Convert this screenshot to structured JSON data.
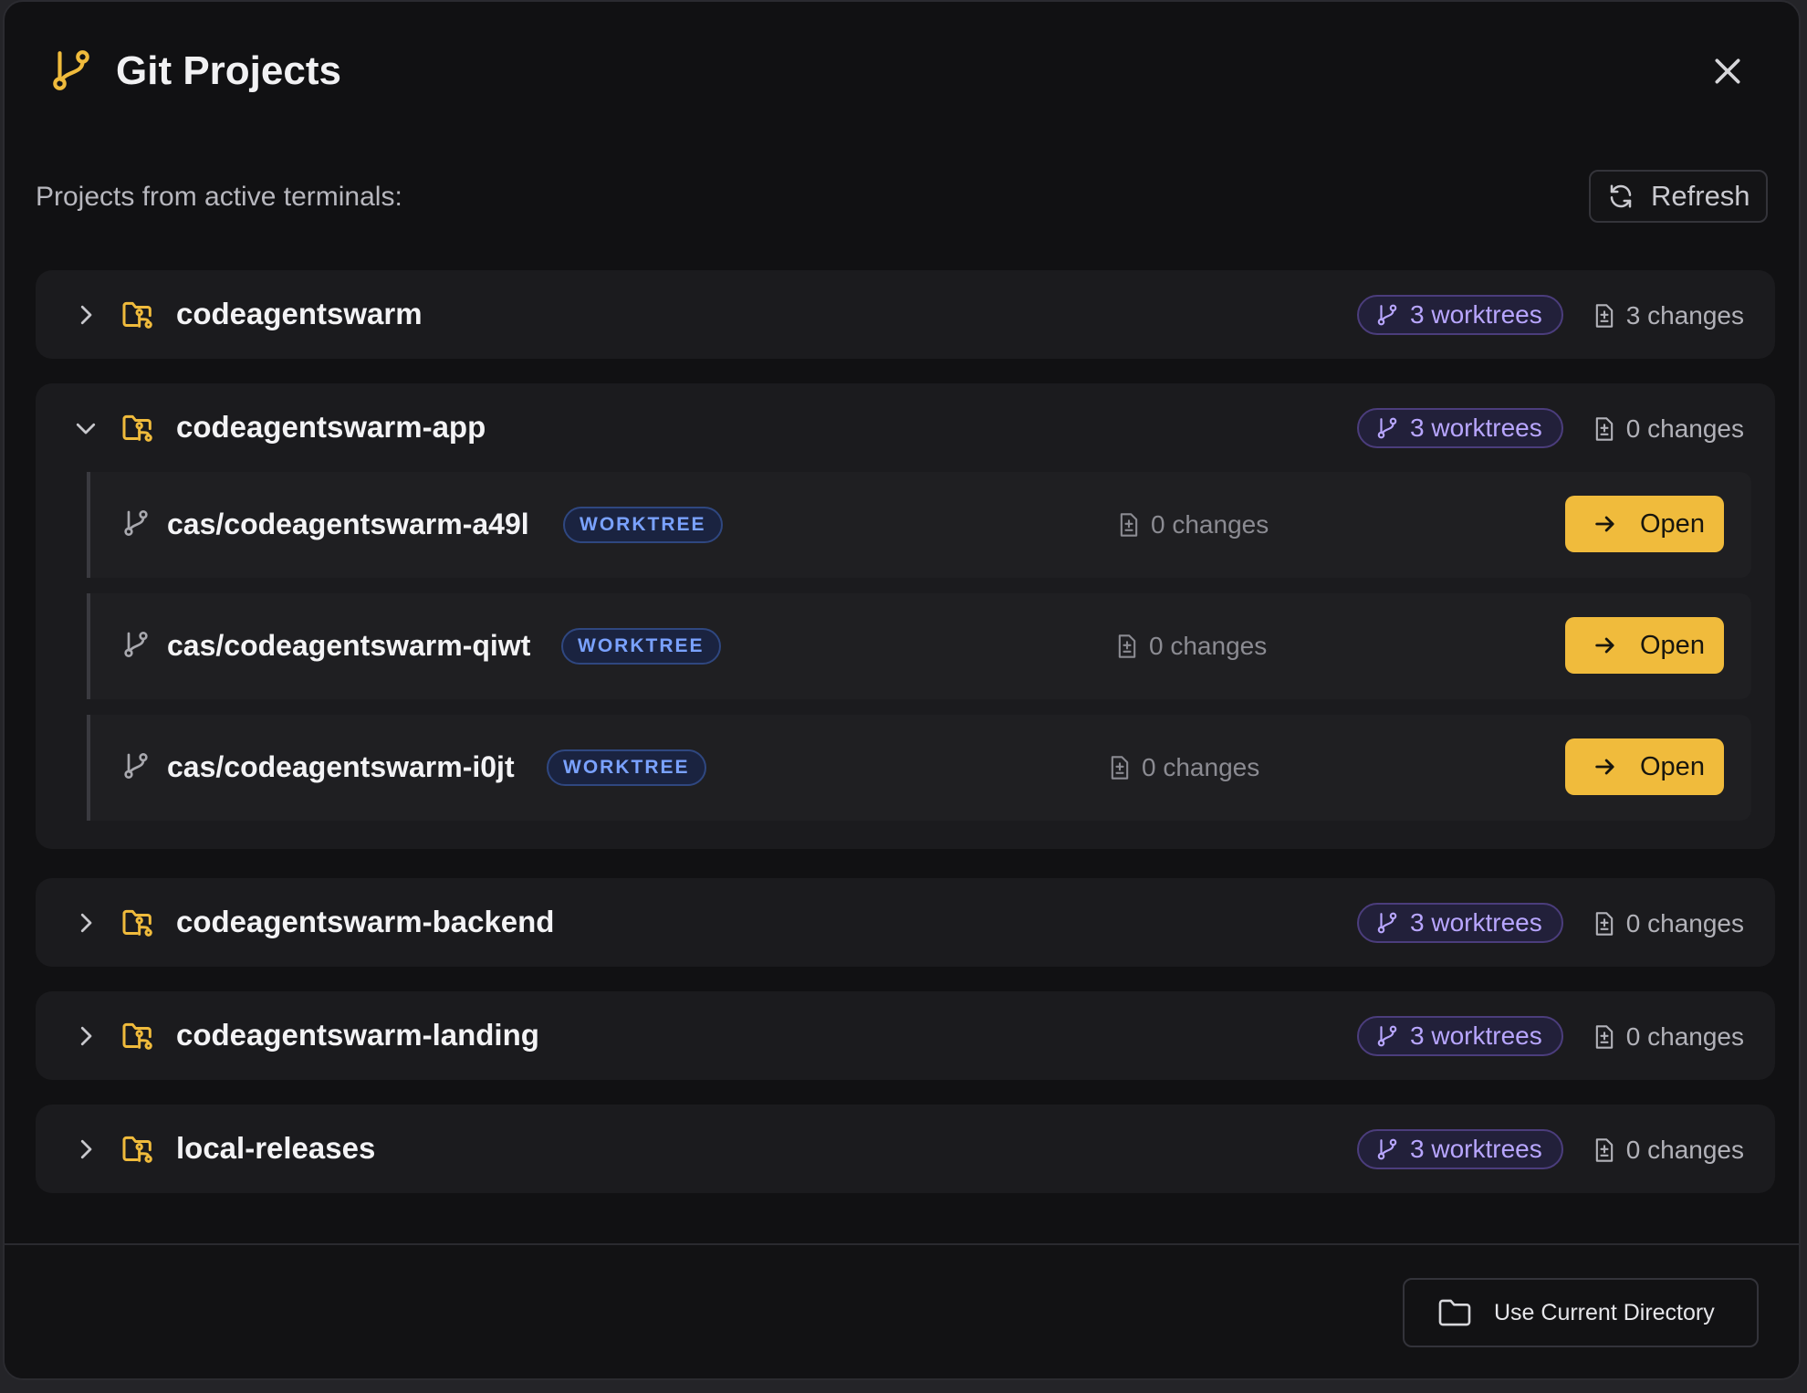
{
  "dialog": {
    "title": "Git Projects",
    "subtitle": "Projects from active terminals:",
    "refresh_label": "Refresh",
    "icons": {
      "logo": "git-branch-icon",
      "close": "close-icon",
      "refresh": "refresh-icon"
    }
  },
  "projects": [
    {
      "name": "codeagentswarm",
      "expanded": false,
      "worktrees_label": "3 worktrees",
      "changes_label": "3 changes"
    },
    {
      "name": "codeagentswarm-app",
      "expanded": true,
      "worktrees_label": "3 worktrees",
      "changes_label": "0 changes",
      "worktrees": [
        {
          "name": "cas/codeagentswarm-a49l",
          "tag": "WORKTREE",
          "changes_label": "0 changes",
          "open_label": "Open"
        },
        {
          "name": "cas/codeagentswarm-qiwt",
          "tag": "WORKTREE",
          "changes_label": "0 changes",
          "open_label": "Open"
        },
        {
          "name": "cas/codeagentswarm-i0jt",
          "tag": "WORKTREE",
          "changes_label": "0 changes",
          "open_label": "Open"
        }
      ]
    },
    {
      "name": "codeagentswarm-backend",
      "expanded": false,
      "worktrees_label": "3 worktrees",
      "changes_label": "0 changes"
    },
    {
      "name": "codeagentswarm-landing",
      "expanded": false,
      "worktrees_label": "3 worktrees",
      "changes_label": "0 changes"
    },
    {
      "name": "local-releases",
      "expanded": false,
      "worktrees_label": "3 worktrees",
      "changes_label": "0 changes"
    }
  ],
  "footer": {
    "use_current_directory_label": "Use Current Directory"
  },
  "colors": {
    "accent": "#f0bb3c",
    "worktree_badge": "#b8a6ff",
    "worktree_tag": "#7aa2ff",
    "background": "#111113"
  }
}
